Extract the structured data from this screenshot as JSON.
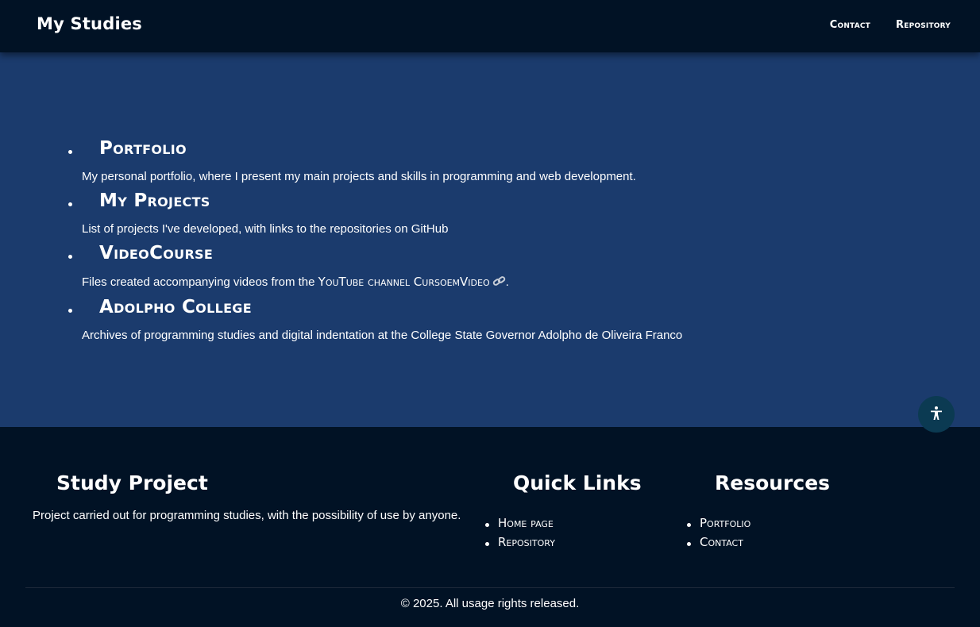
{
  "header": {
    "brand": "My Studies",
    "nav": [
      {
        "label": "Contact"
      },
      {
        "label": "Repository"
      }
    ]
  },
  "studies": [
    {
      "title": "Portfolio",
      "description": "My personal portfolio, where I present my main projects and skills in programming and web development."
    },
    {
      "title": "My Projects",
      "description": "List of projects I've developed, with links to the repositories on GitHub"
    },
    {
      "title": "VideoCourse",
      "description_prefix": "Files created accompanying videos from the ",
      "link_text": "YouTube channel CursoemVideo",
      "description_suffix": "."
    },
    {
      "title": "Adolpho College",
      "description": "Archives of programming studies and digital indentation at the College State Governor Adolpho de Oliveira Franco"
    }
  ],
  "accessibility_icon": "accessibility-person-icon",
  "link_icon": "link-chain-icon",
  "footer": {
    "about": {
      "title": "Study Project",
      "description": "Project carried out for programming studies, with the possibility of use by anyone."
    },
    "quick_links": {
      "title": "Quick Links",
      "items": [
        {
          "label": "Home page"
        },
        {
          "label": "Repository"
        }
      ]
    },
    "resources": {
      "title": "Resources",
      "items": [
        {
          "label": "Portfolio"
        },
        {
          "label": "Contact"
        }
      ]
    },
    "copyright": "© 2025. All usage rights released."
  },
  "colors": {
    "header_bg": "#011225",
    "main_bg": "#1b3b6d",
    "footer_bg": "#011225",
    "accessibility_btn": "#0b3a52",
    "text": "#ffffff"
  }
}
